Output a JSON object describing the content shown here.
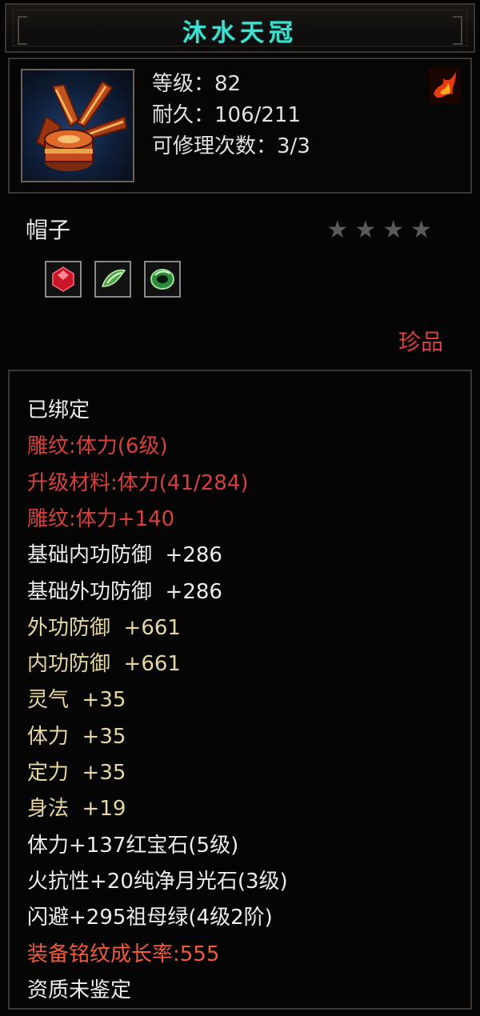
{
  "item": {
    "title": "沐水天冠",
    "level_line": "等级：82",
    "durability_line": "耐久：106/211",
    "repair_line": "可修理次数：3/3",
    "type": "帽子",
    "stars": "★★★★",
    "quality": "珍品"
  },
  "icons": [
    "crown-helmet-icon",
    "fire-element-icon",
    "ruby-gem-icon",
    "moonstone-gem-icon",
    "emerald-gem-icon"
  ],
  "attributes": [
    {
      "text": "已绑定",
      "color": "white"
    },
    {
      "text": "雕纹:体力(6级)",
      "color": "red"
    },
    {
      "text": "升级材料:体力(41/284)",
      "color": "red"
    },
    {
      "text": "雕纹:体力+140",
      "color": "red"
    },
    {
      "text": "基础内功防御  +286",
      "color": "white"
    },
    {
      "text": "基础外功防御  +286",
      "color": "white"
    },
    {
      "text": "外功防御  +661",
      "color": "tan"
    },
    {
      "text": "内功防御  +661",
      "color": "tan"
    },
    {
      "text": "灵气  +35",
      "color": "tan"
    },
    {
      "text": "体力  +35",
      "color": "tan"
    },
    {
      "text": "定力  +35",
      "color": "tan"
    },
    {
      "text": "身法  +19",
      "color": "tan"
    },
    {
      "text": "体力+137红宝石(5级)",
      "color": "white"
    },
    {
      "text": "火抗性+20纯净月光石(3级)",
      "color": "white"
    },
    {
      "text": "闪避+295祖母绿(4级2阶)",
      "color": "white"
    },
    {
      "text": "装备铭纹成长率:555",
      "color": "orange"
    },
    {
      "text": "资质未鉴定",
      "color": "white"
    }
  ],
  "colors": {
    "title": "#3ee0d0",
    "white": "#ececec",
    "red": "#d8413b",
    "tan": "#e6d6a0",
    "orange": "#ef5b3c",
    "quality": "#d8413b"
  }
}
